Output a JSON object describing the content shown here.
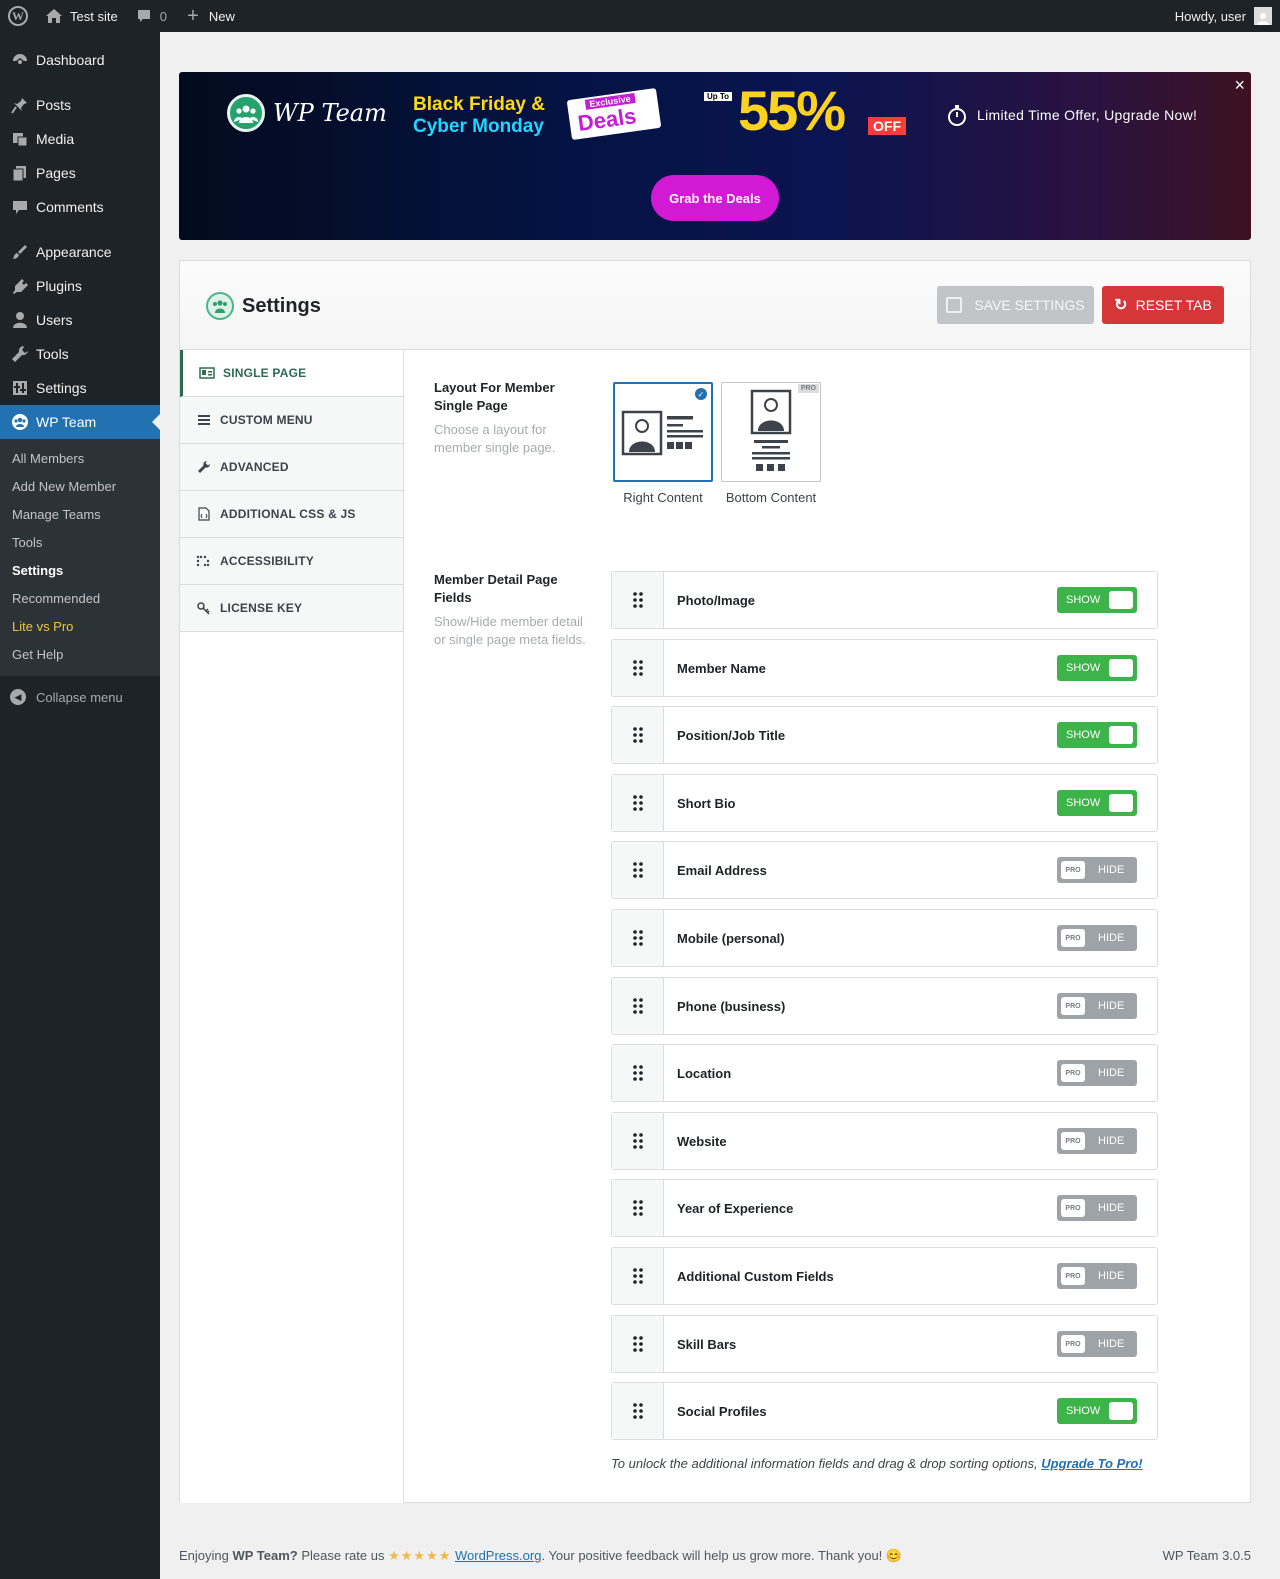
{
  "adminbar": {
    "site_name": "Test site",
    "comments_count": "0",
    "new_label": "New",
    "howdy": "Howdy, user"
  },
  "sidebar": {
    "items": [
      {
        "label": "Dashboard",
        "icon": "dashboard-icon"
      },
      {
        "label": "Posts",
        "icon": "pin-icon"
      },
      {
        "label": "Media",
        "icon": "media-icon"
      },
      {
        "label": "Pages",
        "icon": "pages-icon"
      },
      {
        "label": "Comments",
        "icon": "comment-icon"
      },
      {
        "label": "Appearance",
        "icon": "brush-icon"
      },
      {
        "label": "Plugins",
        "icon": "plugin-icon"
      },
      {
        "label": "Users",
        "icon": "user-icon"
      },
      {
        "label": "Tools",
        "icon": "wrench-icon"
      },
      {
        "label": "Settings",
        "icon": "settings-icon"
      },
      {
        "label": "WP Team",
        "icon": "team-icon"
      }
    ],
    "submenu": [
      "All Members",
      "Add New Member",
      "Manage Teams",
      "Tools",
      "Settings",
      "Recommended",
      "Lite vs Pro",
      "Get Help"
    ],
    "collapse": "Collapse menu"
  },
  "banner": {
    "logo_text": "WP Team",
    "line1": "Black Friday &",
    "line2": "Cyber Monday",
    "exclusive": "Exclusive",
    "deals": "Deals",
    "upto": "Up To",
    "percent": "55%",
    "off": "OFF",
    "offer_text": "Limited Time Offer, Upgrade Now!",
    "cta": "Grab the Deals",
    "close": "×"
  },
  "panel": {
    "title": "Settings",
    "save_label": "SAVE SETTINGS",
    "reset_label": "RESET TAB"
  },
  "tabs": [
    "SINGLE PAGE",
    "CUSTOM MENU",
    "ADVANCED",
    "ADDITIONAL CSS & JS",
    "ACCESSIBILITY",
    "LICENSE KEY"
  ],
  "layout_field": {
    "title": "Layout For Member Single Page",
    "desc": "Choose a layout for member single page.",
    "options": [
      "Right Content",
      "Bottom Content"
    ],
    "pro_tag": "PRO"
  },
  "detail_field": {
    "title": "Member Detail Page Fields",
    "desc": "Show/Hide member detail or single page meta fields."
  },
  "fields": [
    {
      "name": "Photo/Image",
      "state": "SHOW",
      "pro": false
    },
    {
      "name": "Member Name",
      "state": "SHOW",
      "pro": false
    },
    {
      "name": "Position/Job Title",
      "state": "SHOW",
      "pro": false
    },
    {
      "name": "Short Bio",
      "state": "SHOW",
      "pro": false
    },
    {
      "name": "Email Address",
      "state": "HIDE",
      "pro": true
    },
    {
      "name": "Mobile (personal)",
      "state": "HIDE",
      "pro": true
    },
    {
      "name": "Phone (business)",
      "state": "HIDE",
      "pro": true
    },
    {
      "name": "Location",
      "state": "HIDE",
      "pro": true
    },
    {
      "name": "Website",
      "state": "HIDE",
      "pro": true
    },
    {
      "name": "Year of Experience",
      "state": "HIDE",
      "pro": true
    },
    {
      "name": "Additional Custom Fields",
      "state": "HIDE",
      "pro": true
    },
    {
      "name": "Skill Bars",
      "state": "HIDE",
      "pro": true
    },
    {
      "name": "Social Profiles",
      "state": "SHOW",
      "pro": false
    }
  ],
  "pro_badge": "PRO",
  "note": {
    "text": "To unlock the additional information fields and drag & drop sorting options, ",
    "link": "Upgrade To Pro!"
  },
  "footer": {
    "t1": "Enjoying ",
    "bold": "WP Team?",
    "t2": " Please rate us ",
    "stars": "★★★★★",
    "link": "WordPress.org",
    "t3": ". Your positive feedback will help us grow more. Thank you! 😊",
    "version": "WP Team 3.0.5"
  }
}
